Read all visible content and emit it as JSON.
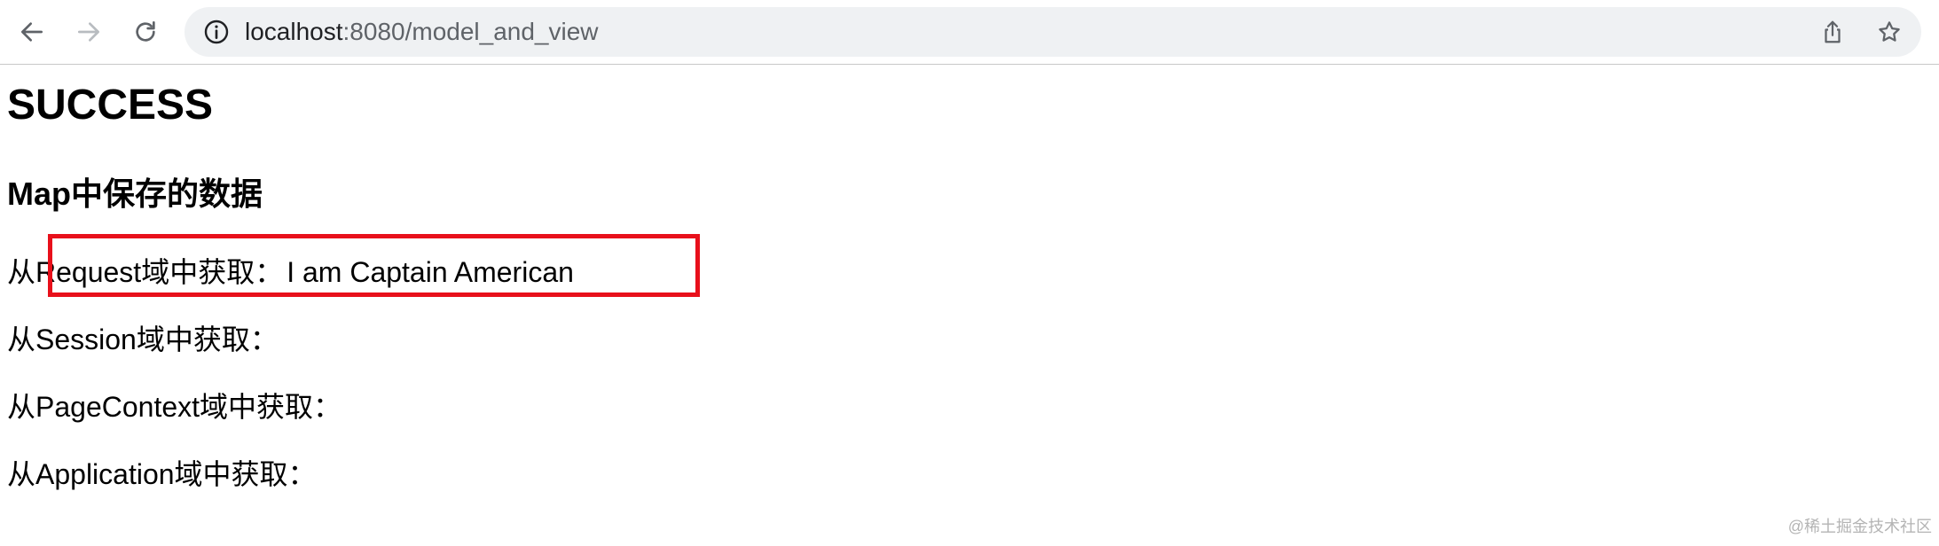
{
  "browser": {
    "url_host": "localhost",
    "url_rest": ":8080/model_and_view",
    "icons": {
      "back": "back-arrow-icon",
      "forward": "forward-arrow-icon",
      "reload": "reload-icon",
      "info": "info-icon",
      "share": "share-icon",
      "bookmark": "star-icon"
    }
  },
  "page": {
    "title": "SUCCESS",
    "subtitle": "Map中保存的数据",
    "rows": [
      {
        "label": "从Request域中获取：",
        "value": "I am Captain American"
      },
      {
        "label": "从Session域中获取：",
        "value": ""
      },
      {
        "label": "从PageContext域中获取：",
        "value": ""
      },
      {
        "label": "从Application域中获取：",
        "value": ""
      }
    ]
  },
  "annotation": {
    "color": "#e8101b"
  },
  "watermark": "@稀土掘金技术社区"
}
